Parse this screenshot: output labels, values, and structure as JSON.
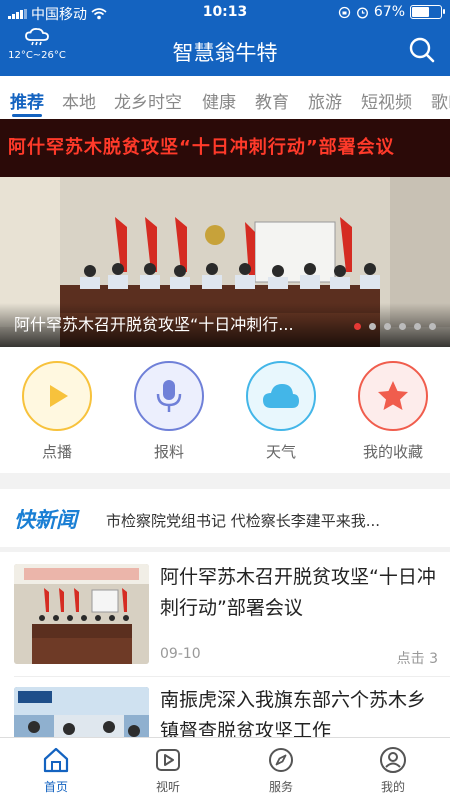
{
  "status": {
    "carrier": "中国移动",
    "time": "10:13",
    "battery": "67%",
    "battery_level": 0.67
  },
  "header": {
    "title": "智慧翁牛特",
    "weather_range": "12°C~26°C",
    "weather_icon": "cloud-rain-icon",
    "search_icon": "search-icon"
  },
  "tabs": [
    {
      "label": "推荐",
      "active": true
    },
    {
      "label": "本地"
    },
    {
      "label": "龙乡时空"
    },
    {
      "label": "健康"
    },
    {
      "label": "教育"
    },
    {
      "label": "旅游"
    },
    {
      "label": "短视频"
    },
    {
      "label": "歌H"
    }
  ],
  "banner": {
    "sign_text": "阿什罕苏木脱贫攻坚“十日冲刺行动”部署会议",
    "caption": "阿什罕苏木召开脱贫攻坚“十日冲刺行...",
    "dot_count": 6,
    "active_dot": 0
  },
  "quick_actions": [
    {
      "label": "点播",
      "icon": "play-icon",
      "color": "#f7c23c",
      "bg": "#fff8e0"
    },
    {
      "label": "报料",
      "icon": "microphone-icon",
      "color": "#6f80d8",
      "bg": "#eceffd"
    },
    {
      "label": "天气",
      "icon": "cloud-icon",
      "color": "#43b6e8",
      "bg": "#e8f7fd"
    },
    {
      "label": "我的收藏",
      "icon": "star-icon",
      "color": "#f05d4d",
      "bg": "#fdeceb"
    }
  ],
  "flash_news": {
    "logo": "快新闻",
    "text": "市检察院党组书记  代检察长李建平来我..."
  },
  "news": [
    {
      "title": "阿什罕苏木召开脱贫攻坚“十日冲刺行动”部署会议",
      "date": "09-10",
      "clicks": "点击 3"
    },
    {
      "title": "南振虎深入我旗东部六个苏木乡镇督查脱贫攻坚工作",
      "date": "",
      "clicks": ""
    }
  ],
  "bottom_nav": [
    {
      "label": "首页",
      "icon": "home-icon",
      "active": true
    },
    {
      "label": "视听",
      "icon": "video-play-icon"
    },
    {
      "label": "服务",
      "icon": "compass-icon"
    },
    {
      "label": "我的",
      "icon": "user-icon"
    }
  ],
  "colors": {
    "brand": "#1463c0",
    "accent_red": "#e53935"
  }
}
